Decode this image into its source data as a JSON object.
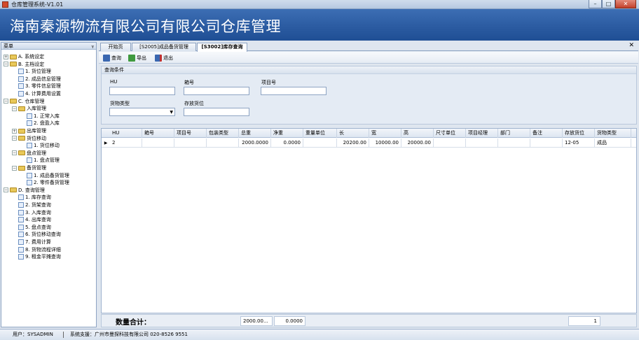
{
  "window": {
    "title": "仓库管理系统-V1.01",
    "min": "–",
    "max": "□",
    "close": "✕"
  },
  "banner": {
    "title": "海南秦源物流有限公司有限公司仓库管理"
  },
  "menu": {
    "title": "菜单",
    "pin": "ᚁ",
    "items": [
      {
        "label": "A. 系统设定",
        "kind": "folder",
        "level": 0,
        "exp": "+"
      },
      {
        "label": "B. 主档设定",
        "kind": "folder",
        "level": 0,
        "exp": "−"
      },
      {
        "label": "1. 货位管理",
        "kind": "doc",
        "level": 1
      },
      {
        "label": "2. 成品信息管理",
        "kind": "doc",
        "level": 1
      },
      {
        "label": "3. 零件信息管理",
        "kind": "doc",
        "level": 1
      },
      {
        "label": "4. 计算费用设置",
        "kind": "doc",
        "level": 1
      },
      {
        "label": "C. 仓库管理",
        "kind": "folder",
        "level": 0,
        "exp": "−"
      },
      {
        "label": "入库管理",
        "kind": "folder",
        "level": 1,
        "exp": "−"
      },
      {
        "label": "1. 正常入库",
        "kind": "doc",
        "level": 2
      },
      {
        "label": "2. 盘盈入库",
        "kind": "doc",
        "level": 2
      },
      {
        "label": "出库管理",
        "kind": "folder",
        "level": 1,
        "exp": "+"
      },
      {
        "label": "货位移动",
        "kind": "folder",
        "level": 1,
        "exp": "−"
      },
      {
        "label": "1. 货位移动",
        "kind": "doc",
        "level": 2
      },
      {
        "label": "盘点管理",
        "kind": "folder",
        "level": 1,
        "exp": "−"
      },
      {
        "label": "1. 盘点管理",
        "kind": "doc",
        "level": 2
      },
      {
        "label": "备货管理",
        "kind": "folder",
        "level": 1,
        "exp": "−"
      },
      {
        "label": "1. 成品备货管理",
        "kind": "doc",
        "level": 2
      },
      {
        "label": "2. 零件备货管理",
        "kind": "doc",
        "level": 2
      },
      {
        "label": "D. 查询管理",
        "kind": "folder",
        "level": 0,
        "exp": "−"
      },
      {
        "label": "1. 库存查询",
        "kind": "doc",
        "level": 1
      },
      {
        "label": "2. 货架查询",
        "kind": "doc",
        "level": 1
      },
      {
        "label": "3. 入库查询",
        "kind": "doc",
        "level": 1
      },
      {
        "label": "4. 出库查询",
        "kind": "doc",
        "level": 1
      },
      {
        "label": "5. 盘点查询",
        "kind": "doc",
        "level": 1
      },
      {
        "label": "6. 货位移动查询",
        "kind": "doc",
        "level": 1
      },
      {
        "label": "7. 费用计算",
        "kind": "doc",
        "level": 1
      },
      {
        "label": "8. 货物流程详细",
        "kind": "doc",
        "level": 1
      },
      {
        "label": "9. 租金平摊查询",
        "kind": "doc",
        "level": 1
      }
    ]
  },
  "tabs": [
    {
      "label": "开始页"
    },
    {
      "label": "[S2005]成品备货管理"
    },
    {
      "label": "[S3002]库存查询"
    }
  ],
  "tab_close": "✕",
  "toolbar": {
    "query": "查询",
    "export": "导出",
    "exit": "退出"
  },
  "criteria": {
    "title": "查询条件",
    "hu_label": "HU",
    "box_label": "箱号",
    "project_label": "项目号",
    "goods_type_label": "货物类型",
    "location_label": "存放货位",
    "hu_value": "",
    "box_value": "",
    "project_value": "",
    "goods_type_value": "",
    "location_value": ""
  },
  "grid": {
    "headers": [
      "HU",
      "箱号",
      "项目号",
      "包装类型",
      "总重",
      "净重",
      "重量单位",
      "长",
      "宽",
      "高",
      "尺寸单位",
      "项目经理",
      "部门",
      "备注",
      "存放货位",
      "货物类型"
    ],
    "rows": [
      [
        "2",
        "",
        "",
        "",
        "2000.0000",
        "0.0000",
        "",
        "20200.00",
        "10000.00",
        "20000.00",
        "",
        "",
        "",
        "",
        "12-05",
        "成品"
      ]
    ],
    "row_indicator": "▶"
  },
  "totals": {
    "label": "数量合计：",
    "total_weight": "2000.00...",
    "net_weight": "0.0000",
    "count": "1"
  },
  "status": {
    "user": "用户：SYSADMIN",
    "support": "系统支援：广州市曼探科技有限公司 020-8526 9551"
  }
}
